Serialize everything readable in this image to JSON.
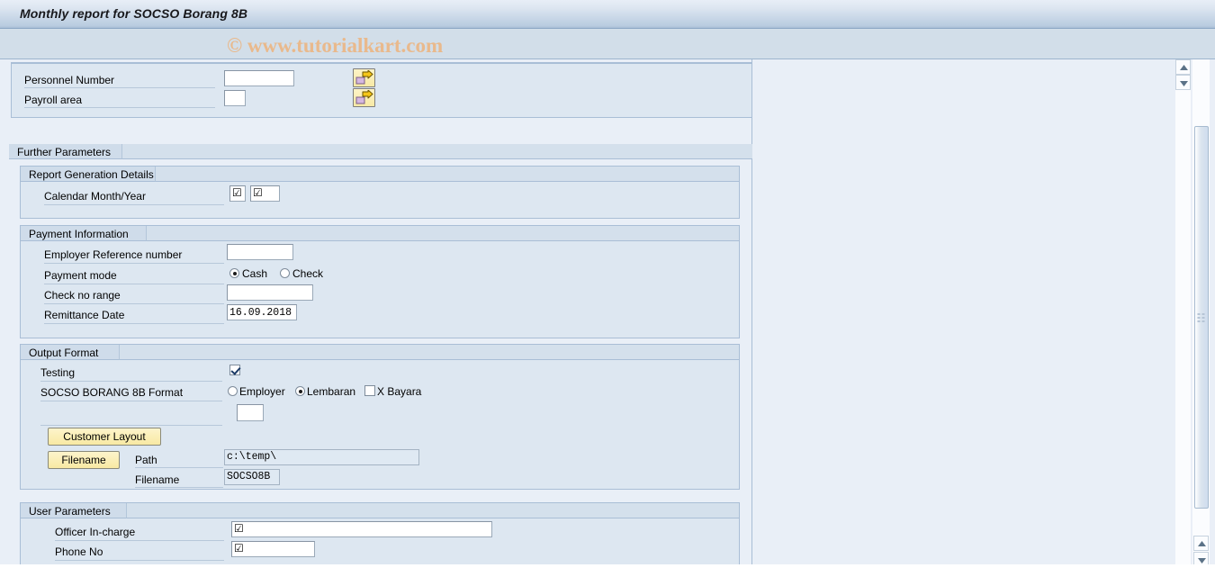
{
  "window": {
    "title": "Monthly report for SOCSO Borang 8B",
    "watermark": "© www.tutorialkart.com"
  },
  "selection": {
    "fields": [
      {
        "label": "Personnel Number",
        "value": "",
        "has_multiple_selection": true
      },
      {
        "label": "Payroll area",
        "value": "",
        "has_multiple_selection": true
      }
    ],
    "multi_select_icon": "multiple-selection-arrow-icon"
  },
  "further_parameters": {
    "title": "Further Parameters",
    "report_generation": {
      "title": "Report Generation Details",
      "calendar_label": "Calendar Month/Year",
      "month_value": "☑",
      "year_value": "☑"
    },
    "payment_information": {
      "title": "Payment Information",
      "employer_ref_label": "Employer Reference number",
      "employer_ref_value": "",
      "payment_mode_label": "Payment mode",
      "payment_mode_options": [
        {
          "label": "Cash",
          "selected": true
        },
        {
          "label": "Check",
          "selected": false
        }
      ],
      "check_no_range_label": "Check no range",
      "check_no_range_value": "",
      "remittance_date_label": "Remittance Date",
      "remittance_date_value": "16.09.2018"
    },
    "output_format": {
      "title": "Output Format",
      "testing_label": "Testing",
      "testing_checked": true,
      "format_label": "SOCSO BORANG 8B Format",
      "format_options": [
        {
          "label": "Employer",
          "type": "radio",
          "selected": false
        },
        {
          "label": "Lembaran",
          "type": "radio",
          "selected": true
        },
        {
          "label": "X Bayara",
          "type": "checkbox",
          "selected": false
        }
      ],
      "format_extra_value": "",
      "customer_layout_button": "Customer Layout",
      "filename_button": "Filename",
      "path_label": "Path",
      "path_value": "c:\\temp\\",
      "filename_label": "Filename",
      "filename_value": "SOCSO8B"
    },
    "user_parameters": {
      "title": "User Parameters",
      "officer_label": "Officer In-charge",
      "officer_value": "☑",
      "phone_label": "Phone No",
      "phone_value": "☑"
    }
  },
  "scrollbars": {
    "inner_up_icon": "scroll-up-arrow-icon",
    "inner_down_icon": "scroll-down-arrow-icon",
    "outer_up_icon": "scroll-up-arrow-icon",
    "outer_down_icon": "scroll-down-arrow-icon"
  },
  "colors": {
    "title_accent": "#a9bed6",
    "panel_bg": "#dde7f1",
    "page_bg": "#e9eff7",
    "watermark": "#e9b98c",
    "button_yellow": "#f8e9a3"
  }
}
